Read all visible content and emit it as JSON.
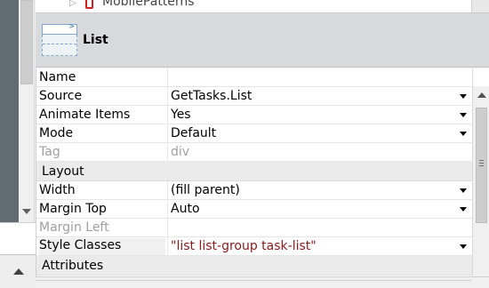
{
  "tree": {
    "item_label": "MobilePatterns"
  },
  "header": {
    "title": "List"
  },
  "properties": [
    {
      "name": "Name",
      "value": "",
      "dropdown": false,
      "disabled": false
    },
    {
      "name": "Source",
      "value": "GetTasks.List",
      "dropdown": true,
      "disabled": false
    },
    {
      "name": "Animate Items",
      "value": "Yes",
      "dropdown": true,
      "disabled": false
    },
    {
      "name": "Mode",
      "value": "Default",
      "dropdown": true,
      "disabled": false
    },
    {
      "name": "Tag",
      "value": "div",
      "dropdown": false,
      "disabled": true
    }
  ],
  "layout_category": {
    "label": "Layout"
  },
  "layout_properties": [
    {
      "name": "Width",
      "value": "(fill parent)",
      "dropdown": true,
      "disabled": false
    },
    {
      "name": "Margin Top",
      "value": "Auto",
      "dropdown": true,
      "disabled": false
    },
    {
      "name": "Margin Left",
      "value": "",
      "dropdown": false,
      "disabled": true
    },
    {
      "name": "Style Classes",
      "value": "\"list list-group task-list\"",
      "dropdown": true,
      "disabled": false
    }
  ],
  "attributes_category": {
    "label": "Attributes"
  },
  "colors": {
    "header_bg": "#d8dadc",
    "string_value": "#8b1a1a",
    "tree_icon": "#d02020",
    "left_strip": "#616b72"
  },
  "icons": {
    "tree_expander": "triangle-right",
    "tree_item": "mobile-phone",
    "dropdown": "triangle-down"
  }
}
